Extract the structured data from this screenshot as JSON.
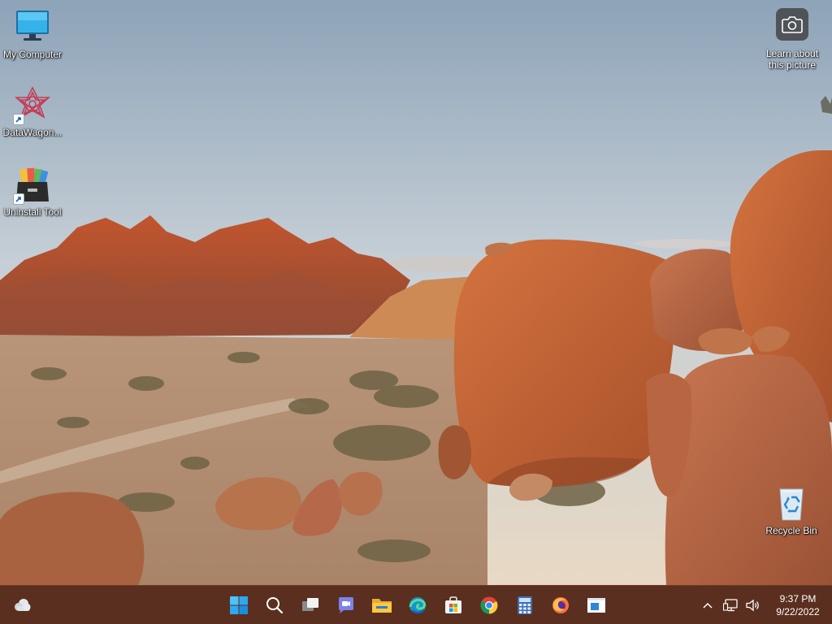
{
  "desktop": {
    "icons": [
      {
        "label": "My Computer",
        "icon": "monitor-icon"
      },
      {
        "label": "DataWagon...",
        "icon": "datawagon-app-icon",
        "shortcut": true
      },
      {
        "label": "Uninstall Tool",
        "icon": "uninstall-tool-icon",
        "shortcut": true
      },
      {
        "label": "Recycle Bin",
        "icon": "recycle-bin-icon"
      }
    ],
    "learn_picture": {
      "label_line1": "Learn about",
      "label_line2": "this picture",
      "icon": "camera-icon"
    }
  },
  "taskbar": {
    "color": "#5a2f1f",
    "widgets_icon": "weather-cloud-icon",
    "apps": [
      {
        "name": "Start",
        "icon": "windows-start-icon"
      },
      {
        "name": "Search",
        "icon": "search-icon"
      },
      {
        "name": "Task View",
        "icon": "task-view-icon"
      },
      {
        "name": "Chat",
        "icon": "teams-chat-icon"
      },
      {
        "name": "File Explorer",
        "icon": "file-explorer-icon"
      },
      {
        "name": "Microsoft Edge",
        "icon": "edge-icon"
      },
      {
        "name": "Microsoft Store",
        "icon": "store-icon"
      },
      {
        "name": "Google Chrome",
        "icon": "chrome-icon"
      },
      {
        "name": "Calculator",
        "icon": "calculator-icon"
      },
      {
        "name": "Firefox",
        "icon": "firefox-icon"
      },
      {
        "name": "App",
        "icon": "window-app-icon"
      }
    ],
    "tray": {
      "icons": [
        "chevron-up-icon",
        "network-icon",
        "volume-icon"
      ]
    },
    "clock": {
      "time": "9:37 PM",
      "date": "9/22/2022"
    }
  }
}
